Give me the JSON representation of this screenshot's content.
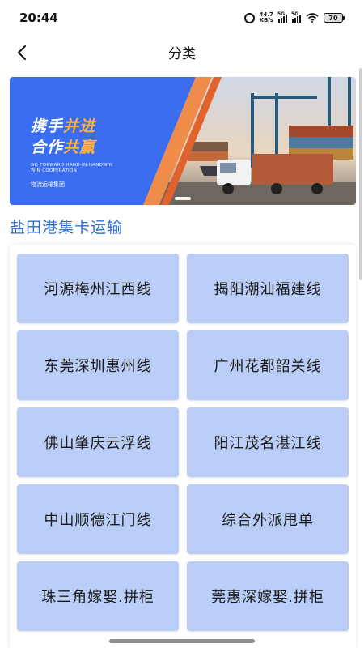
{
  "status": {
    "time": "20:44",
    "net_speed_value": "44.7",
    "net_speed_unit": "KB/s",
    "signal1_label": "5G",
    "signal2_label": "5G",
    "battery": "70"
  },
  "header": {
    "title": "分类",
    "back_icon": "chevron-left-icon"
  },
  "banner": {
    "line1_a": "携手",
    "line1_b": "并进",
    "line2_a": "合作",
    "line2_b": "共赢",
    "english_1": "GO FORWARD HAND-IN-HANDWIN",
    "english_2": "WIN COOPERATION",
    "company": "物流运输集团",
    "accent_color": "#3a6df0",
    "highlight_color": "#ffb13c"
  },
  "section": {
    "title": "盐田港集卡运输"
  },
  "routes": [
    {
      "label": "河源梅州江西线"
    },
    {
      "label": "揭阳潮汕福建线"
    },
    {
      "label": "东莞深圳惠州线"
    },
    {
      "label": "广州花都韶关线"
    },
    {
      "label": "佛山肇庆云浮线"
    },
    {
      "label": "阳江茂名湛江线"
    },
    {
      "label": "中山顺德江门线"
    },
    {
      "label": "综合外派甩单"
    },
    {
      "label": "珠三角嫁娶.拼柜"
    },
    {
      "label": "莞惠深嫁娶.拼柜"
    }
  ]
}
